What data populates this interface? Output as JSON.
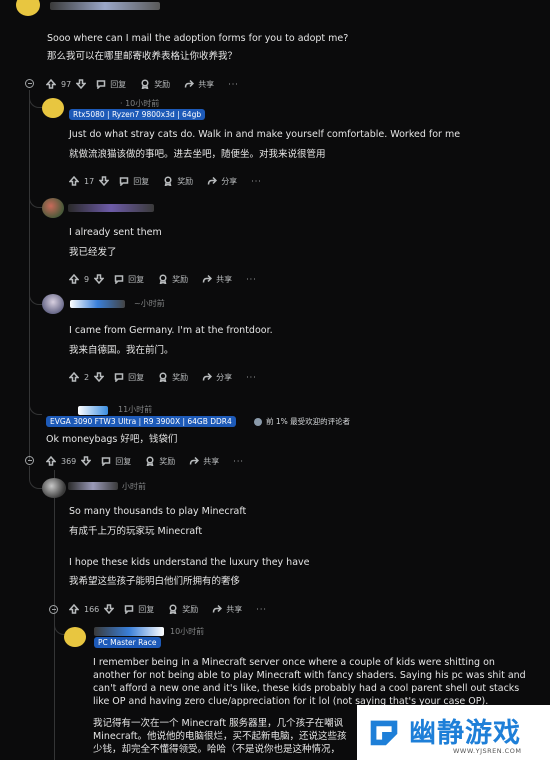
{
  "comments": [
    {
      "id": "c1",
      "text_en": "Sooo where can I mail the adoption forms for you to adopt me?",
      "text_zh": "那么我可以在哪里邮寄收养表格让你收养我？",
      "votes": "97",
      "reply": "回复",
      "award": "奖励",
      "share": "共享"
    },
    {
      "id": "c2",
      "time": "· 10小时前",
      "flair": "Rtx5080 | Ryzen7 9800x3d | 64gb",
      "text_en": "Just do what stray cats do. Walk in and make yourself comfortable. Worked for me",
      "text_zh": "就做流浪猫该做的事吧。进去坐吧，随便坐。对我来说很管用",
      "votes": "17",
      "reply": "回复",
      "award": "奖励",
      "share": "分享"
    },
    {
      "id": "c3",
      "text_en": "I already sent them",
      "text_zh": "我已经发了",
      "votes": "9",
      "reply": "回复",
      "award": "奖励",
      "share": "共享"
    },
    {
      "id": "c4",
      "time": "~小时前",
      "text_en": "I came from Germany. I'm at the frontdoor.",
      "text_zh": "我来自德国。我在前门。",
      "votes": "2",
      "reply": "回复",
      "award": "奖励",
      "share": "分享"
    },
    {
      "id": "c5",
      "time": "11小时前",
      "flair": "EVGA 3090 FTW3 Ultra | R9 3900X | 64GB DDR4",
      "badge": "前 1% 最受欢迎的评论者",
      "text_en": "Ok moneybags  好吧，钱袋们",
      "votes": "369",
      "reply": "回复",
      "award": "奖励",
      "share": "共享"
    },
    {
      "id": "c6",
      "time": "小时前",
      "text_en": "So many thousands to play Minecraft",
      "text_zh": "有成千上万的玩家玩 Minecraft",
      "text_en2": "I hope these kids understand the luxury they have",
      "text_zh2": "我希望这些孩子能明白他们所拥有的奢侈",
      "votes": "166",
      "reply": "回复",
      "award": "奖励",
      "share": "共享"
    },
    {
      "id": "c7",
      "time": "10小时前",
      "flair": "PC Master Race",
      "text_en": "I remember being in a Minecraft server once where a couple of kids were shitting on another for not being able to play Minecraft with fancy shaders. Saying his pc was shit and can't afford a new one and it's like, these kids probably had a cool parent shell out stacks like OP and having zero clue/appreciation for it lol (not saying that's your case OP).",
      "text_zh": "我记得有一次在一个 Minecraft 服务器里，几个孩子在嘲讽 Minecraft。他说他的电脑很烂，买不起新电脑，还说这些孩 少钱，却完全不懂得领受。哈哈（不是说你也是这种情况，"
    }
  ],
  "watermark": {
    "title": "幽静游戏",
    "url": "WWW.YJSREN.COM"
  },
  "colors": {
    "background": "#0b0b0c",
    "flair_blue": "#1d5ab8",
    "watermark_blue": "#1e7fd8"
  }
}
